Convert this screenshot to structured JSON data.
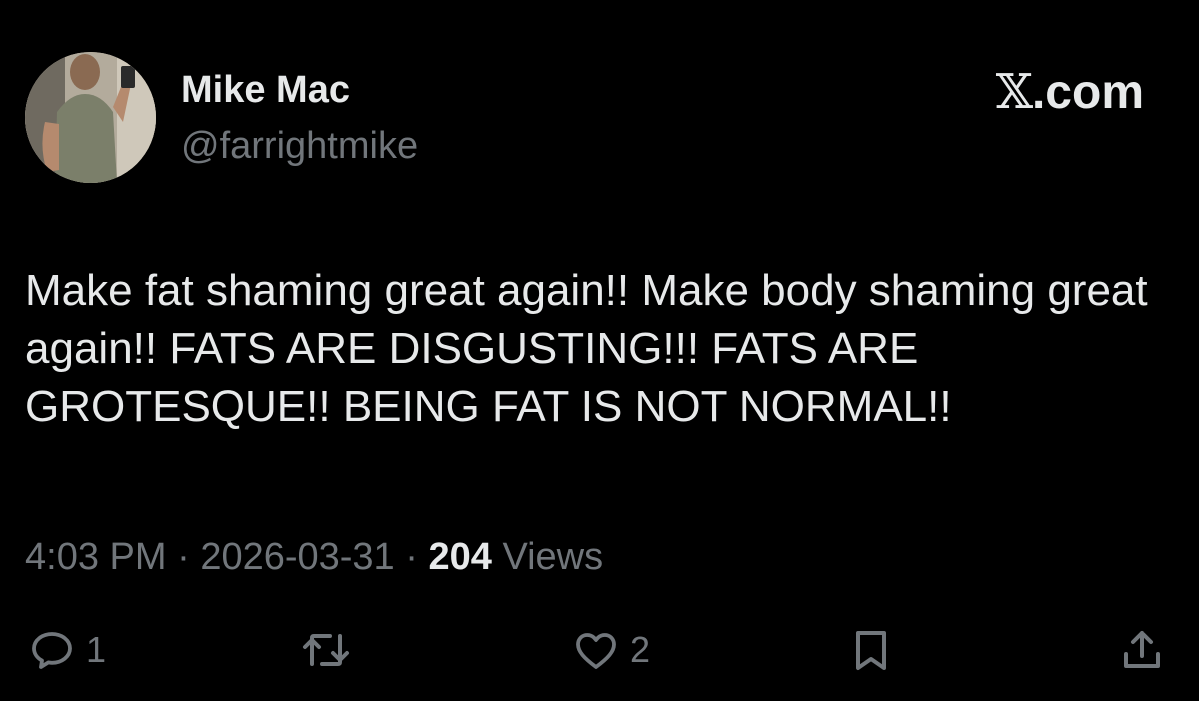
{
  "author": {
    "display_name": "Mike Mac",
    "handle": "@farrightmike"
  },
  "brand": {
    "logo_letter": "𝕏",
    "domain": ".com"
  },
  "tweet": {
    "text": "Make fat shaming great again!! Make body shaming great again!! FATS ARE DISGUSTING!!! FATS ARE GROTESQUE!! BEING FAT IS NOT NORMAL!!"
  },
  "meta": {
    "time": "4:03 PM",
    "separator": " · ",
    "date": "2026-03-31",
    "views_count": "204",
    "views_label": " Views"
  },
  "actions": {
    "reply": {
      "icon": "reply-icon",
      "count": "1"
    },
    "retweet": {
      "icon": "retweet-icon",
      "count": ""
    },
    "like": {
      "icon": "heart-icon",
      "count": "2"
    },
    "bookmark": {
      "icon": "bookmark-icon",
      "count": ""
    },
    "share": {
      "icon": "share-icon",
      "count": ""
    }
  },
  "colors": {
    "background": "#000000",
    "primary_text": "#e7e9ea",
    "secondary_text": "#71767b"
  }
}
